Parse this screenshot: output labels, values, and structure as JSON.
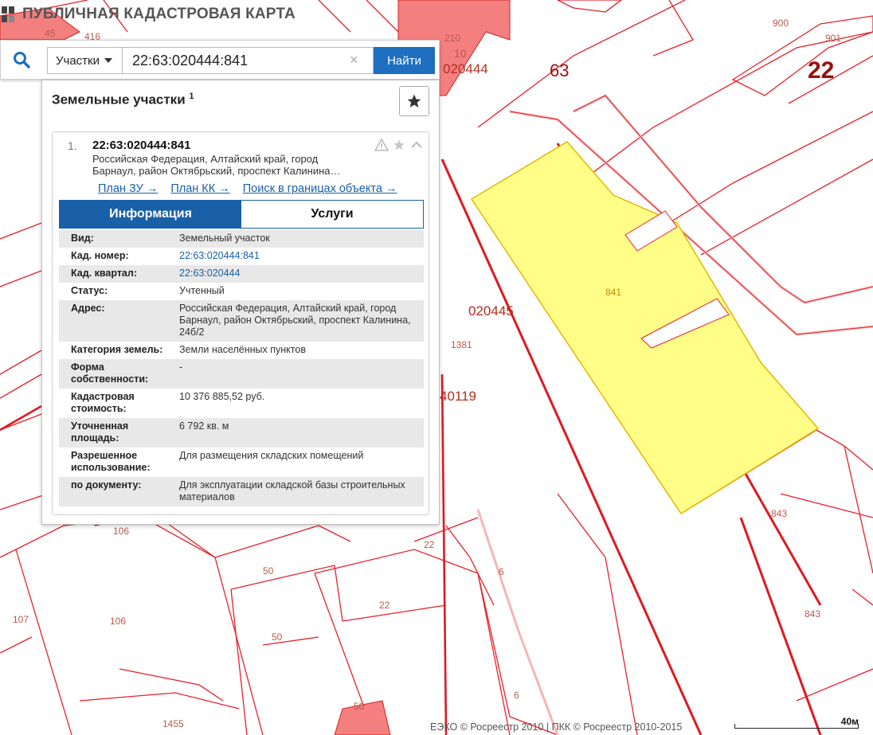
{
  "header": {
    "title": "ПУБЛИЧНАЯ КАДАСТРОВАЯ КАРТА"
  },
  "search": {
    "category": "Участки",
    "query": "22:63:020444:841",
    "clear_symbol": "×",
    "button": "Найти"
  },
  "panel": {
    "title": "Земельные участки",
    "count": "1",
    "result": {
      "index": "1.",
      "cad_number": "22:63:020444:841",
      "address": "Российская Федерация, Алтайский край, город Барнаул, район Октябрьский, проспект Калинина…",
      "links": [
        "План ЗУ →",
        "План КК →",
        "Поиск в границах объекта →"
      ],
      "tabs": {
        "info": "Информация",
        "services": "Услуги"
      },
      "props": [
        {
          "k": "Вид:",
          "v": "Земельный участок"
        },
        {
          "k": "Кад. номер:",
          "v": "22:63:020444:841"
        },
        {
          "k": "Кад. квартал:",
          "v": "22:63:020444"
        },
        {
          "k": "Статус:",
          "v": "Учтенный"
        },
        {
          "k": "Адрес:",
          "v": "Российская Федерация, Алтайский край, город Барнаул, район Октябрьский, проспект Калинина, 24б/2"
        },
        {
          "k": "Категория земель:",
          "v": "Земли населённых пунктов"
        },
        {
          "k": "Форма собственности:",
          "v": "-"
        },
        {
          "k": "Кадастровая стоимость:",
          "v": "10 376 885,52 руб."
        },
        {
          "k": "Уточненная площадь:",
          "v": "6 792 кв. м"
        },
        {
          "k": "Разрешенное использование:",
          "v": "Для размещения складских помещений"
        },
        {
          "k": "по документу:",
          "v": "Для эксплуатации складской базы строительных материалов"
        }
      ]
    }
  },
  "map": {
    "labels": {
      "l45": "45",
      "l416": "416",
      "l210": "210",
      "l10": "10",
      "l020444": "020444",
      "l63": "63",
      "l900": "900",
      "l901": "901",
      "l22big": "22",
      "l841": "841",
      "l020445": "020445",
      "l1381": "1381",
      "l40119": "40119",
      "l843a": "843",
      "l843b": "843",
      "l106a": "106",
      "l106b": "106",
      "l107": "107",
      "l50a": "50",
      "l50b": "50",
      "l50c": "50",
      "l22a": "22",
      "l22b": "22",
      "l6a": "6",
      "l6b": "6",
      "l1455": "1455"
    },
    "colors": {
      "boundary": "#e8202a",
      "parcel_fill": "#ffff88",
      "parcel_stroke": "#e3b800",
      "building_fill": "#f47f7f"
    }
  },
  "footer": {
    "copyright": "ЕЭКО © Росреестр 2010 | ПКК © Росреестр 2010-2015",
    "scale": "40м"
  }
}
